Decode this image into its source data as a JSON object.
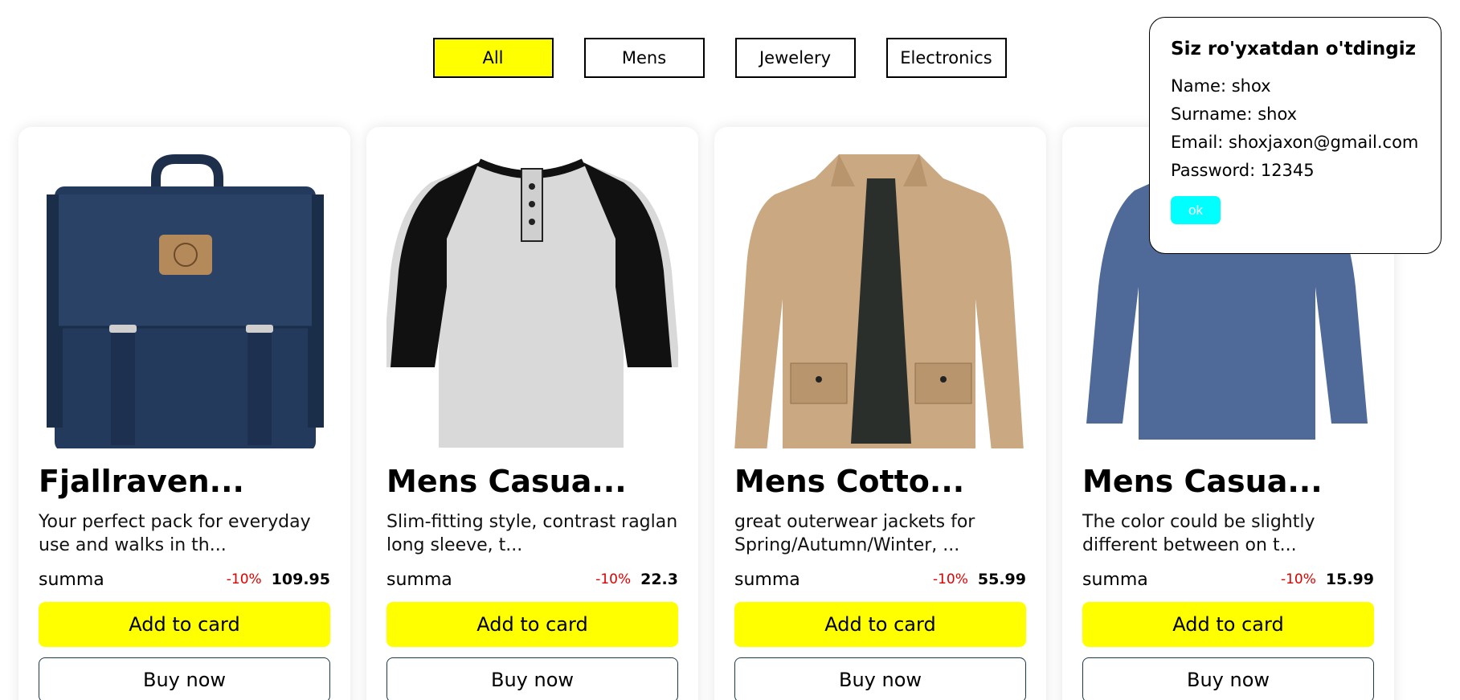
{
  "filters": [
    {
      "label": "All",
      "active": true
    },
    {
      "label": "Mens",
      "active": false
    },
    {
      "label": "Jewelery",
      "active": false
    },
    {
      "label": "Electronics",
      "active": false
    }
  ],
  "products": [
    {
      "image": "backpack-image",
      "title": "Fjallraven...",
      "description": "Your perfect pack for everyday use and walks in th...",
      "price_label": "summa",
      "discount": "-10%",
      "price": "109.95",
      "add_label": "Add to card",
      "buy_label": "Buy now"
    },
    {
      "image": "raglan-tshirt-image",
      "title": "Mens Casua...",
      "description": "Slim-fitting style, contrast raglan long sleeve, t...",
      "price_label": "summa",
      "discount": "-10%",
      "price": "22.3",
      "add_label": "Add to card",
      "buy_label": "Buy now"
    },
    {
      "image": "jacket-image",
      "title": "Mens Cotto...",
      "description": "great outerwear jackets for Spring/Autumn/Winter, ...",
      "price_label": "summa",
      "discount": "-10%",
      "price": "55.99",
      "add_label": "Add to card",
      "buy_label": "Buy now"
    },
    {
      "image": "longsleeve-shirt-image",
      "title": "Mens Casua...",
      "description": "The color could be slightly different between on t...",
      "price_label": "summa",
      "discount": "-10%",
      "price": "15.99",
      "add_label": "Add to card",
      "buy_label": "Buy now"
    }
  ],
  "modal": {
    "title": "Siz ro'yxatdan o'tdingiz",
    "name": "Name: shox",
    "surname": "Surname: shox",
    "email": "Email: shoxjaxon@gmail.com",
    "password": "Password: 12345",
    "ok_label": "ok"
  },
  "colors": {
    "accent_yellow": "#ffff00",
    "discount_red": "#e00000",
    "ok_cyan": "#00ffff",
    "buy_border": "#1b3a4b"
  }
}
